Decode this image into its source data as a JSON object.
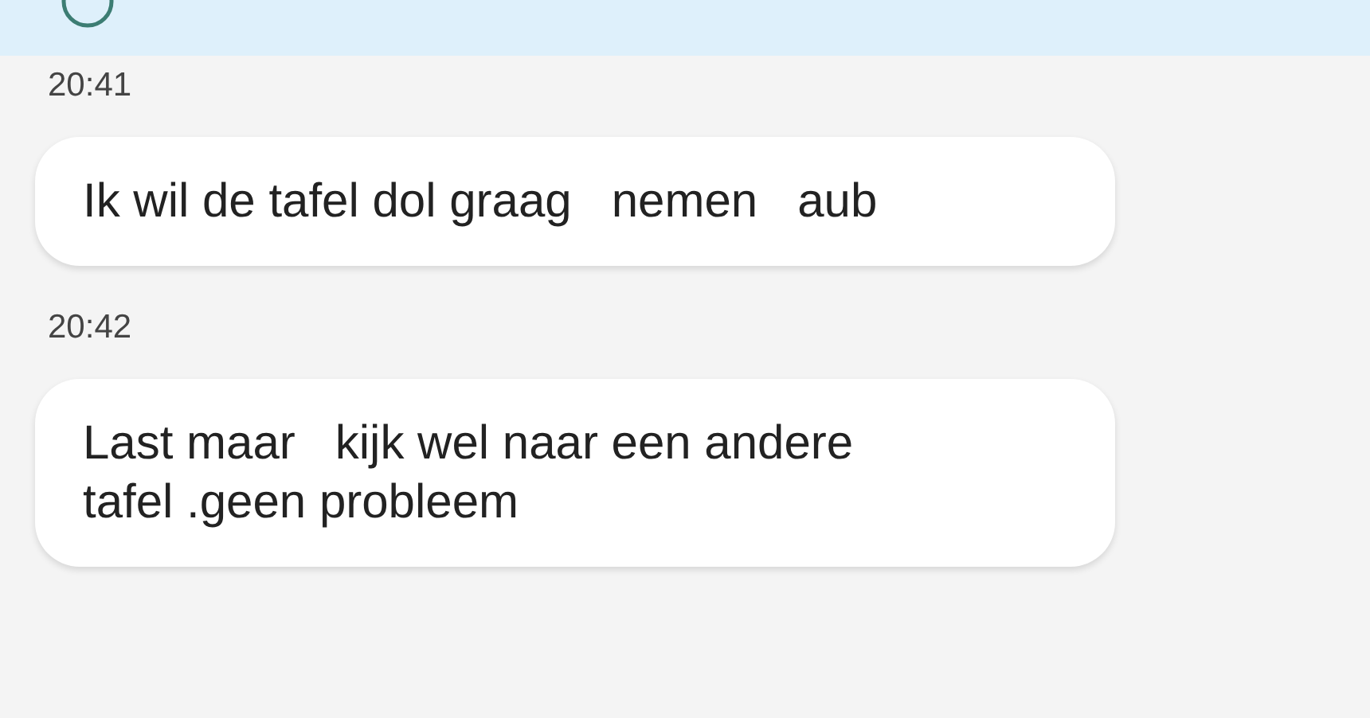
{
  "messages": [
    {
      "time": "20:41",
      "text": "Ik wil de tafel dol graag   nemen   aub"
    },
    {
      "time": "20:42",
      "text": "Last maar   kijk wel naar een andere\ntafel .geen probleem"
    }
  ]
}
